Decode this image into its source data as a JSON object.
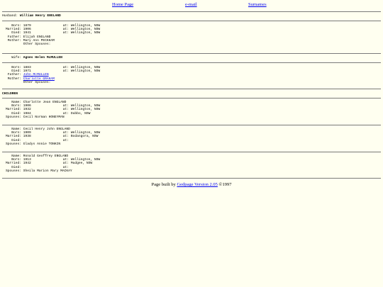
{
  "nav": {
    "home": "Home Page",
    "email": "e-mail",
    "surnames": "Surnames"
  },
  "husband": {
    "label": "Husband:",
    "name": "William Henry ENGLAND",
    "born_label": "Born:",
    "born": "1879",
    "born_at_label": "at:",
    "born_at": "Wellington, NSW",
    "married_label": "Married:",
    "married": "1906",
    "married_at_label": "at:",
    "married_at": "Wellington, NSW",
    "died_label": "Died:",
    "died": "1941",
    "died_at_label": "at:",
    "died_at": "Wellington, NSW",
    "father_label": "Father:",
    "father": "Elijah ENGLAND",
    "mother_label": "Mother:",
    "mother": "Mary Ann PECKHAM",
    "other_spouses": "Other Spouses:"
  },
  "wife": {
    "label": "Wife:",
    "name": "Agnes Helen McMULLEN",
    "born_label": "Born:",
    "born": "1883",
    "born_at_label": "at:",
    "born_at": "Wellington, NSW",
    "died_label": "Died:",
    "died": "1971",
    "died_at_label": "at:",
    "died_at": "Wellington, NSW",
    "father_label": "Father:",
    "father": "John McMULLEN",
    "mother_label": "Mother:",
    "mother": "Charlotte GRAHAM",
    "other_spouses": "Other Spouses:"
  },
  "children_heading": "CHILDREN",
  "children": [
    {
      "name_label": "Name:",
      "name": "Charlotte Jean ENGLAND",
      "born_label": "Born:",
      "born": "1906",
      "born_at_label": "at:",
      "born_at": "Wellington, NSW",
      "married_label": "Married:",
      "married": "1932",
      "married_at_label": "at:",
      "married_at": "Wellington, NSW",
      "died_label": "Died:",
      "died": "1984",
      "died_at_label": "at:",
      "died_at": "Dubbo, NSW",
      "spouses_label": "Spouses:",
      "spouses": "Cecil Norman HONEYMAN"
    },
    {
      "name_label": "Name:",
      "name": "Cecil Henry John ENGLAND",
      "born_label": "Born:",
      "born": "1909",
      "born_at_label": "at:",
      "born_at": "Wellington, NSW",
      "married_label": "Married:",
      "married": "1938",
      "married_at_label": "at:",
      "married_at": "Bodangora, NSW",
      "died_label": "Died:",
      "died": "",
      "died_at_label": "at:",
      "died_at": "",
      "spouses_label": "Spouses:",
      "spouses": "Gladys Annie TONKIN"
    },
    {
      "name_label": "Name:",
      "name": "Ronald Geoffrey ENGLAND",
      "born_label": "Born:",
      "born": "1913",
      "born_at_label": "at:",
      "born_at": "Wellington, NSW",
      "married_label": "Married:",
      "married": "1942",
      "married_at_label": "at:",
      "married_at": "Mudgee, NSW",
      "died_label": "Died:",
      "died": "",
      "died_at_label": "at:",
      "died_at": "",
      "spouses_label": "Spouses:",
      "spouses": "Sheila Marion Mary MACKAY"
    }
  ],
  "footer": {
    "prefix": "Page built by",
    "link": "Gedpage Version 2.05",
    "suffix": "©1997"
  }
}
